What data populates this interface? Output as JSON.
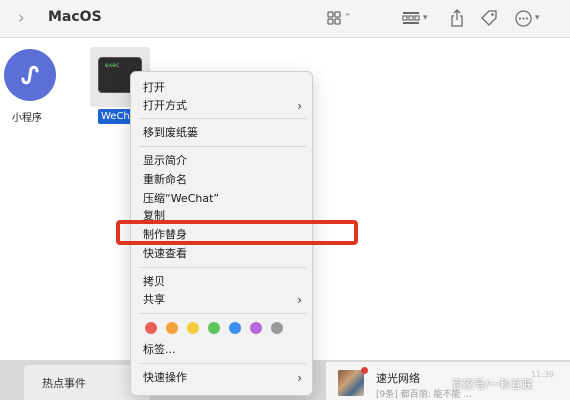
{
  "toolbar": {
    "title": "MacOS",
    "back_glyph": "›",
    "view_icon": "grid-view-icon",
    "group_icon": "group-icon",
    "share_icon": "share-icon",
    "tag_icon": "tag-icon",
    "more_icon": "more-icon"
  },
  "files": [
    {
      "label": "小程序",
      "icon": "mini-program-icon"
    },
    {
      "label": "WeChat",
      "icon": "terminal-exec-icon",
      "icon_text": "exec",
      "selected": true
    }
  ],
  "context_menu": {
    "items": [
      {
        "label": "打开"
      },
      {
        "label": "打开方式",
        "submenu": true
      },
      {
        "label": "移到废纸篓"
      },
      {
        "label": "显示简介"
      },
      {
        "label": "重新命名"
      },
      {
        "label": "压缩“WeChat”"
      },
      {
        "label": "复制"
      },
      {
        "label": "制作替身",
        "highlighted": true
      },
      {
        "label": "快速查看"
      },
      {
        "label": "拷贝"
      },
      {
        "label": "共享",
        "submenu": true
      },
      {
        "label": "标签..."
      },
      {
        "label": "快速操作",
        "submenu": true
      }
    ],
    "submenu_glyph": "›",
    "tag_colors": [
      "#ec5f57",
      "#f5a13c",
      "#f5cc3c",
      "#5cc65a",
      "#3d8ef0",
      "#b868d8",
      "#9a9a9a"
    ]
  },
  "bottom": {
    "left_panel": "热点事件",
    "chat_title": "速光网络",
    "chat_preview": "[9条] 都百丽: 能不能 ...",
    "chat_time": "11:39"
  },
  "watermark": "百家号/一秒互联",
  "colors": {
    "highlight": "#e0361f",
    "selection": "#1c64d3",
    "accent": "#5b6fd6"
  }
}
